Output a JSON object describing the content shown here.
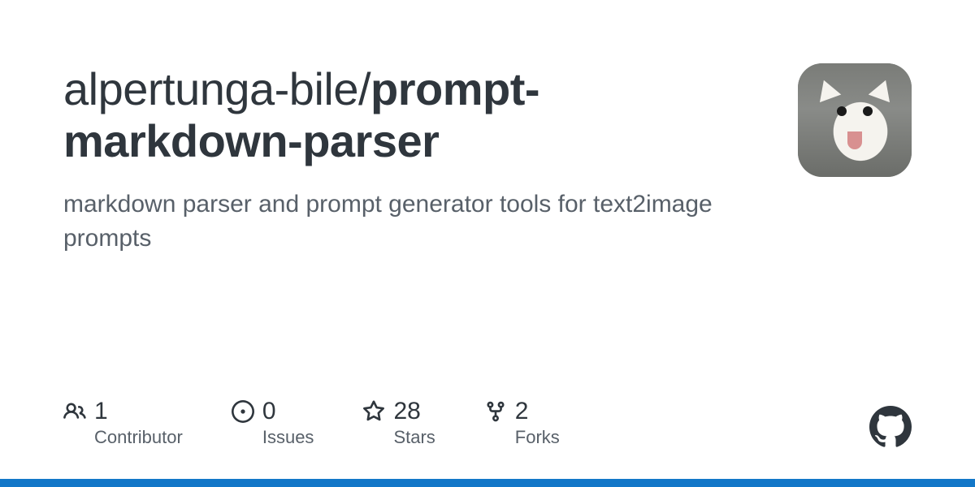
{
  "repo": {
    "owner": "alpertunga-bile",
    "separator": "/",
    "name": "prompt-markdown-parser",
    "description": "markdown parser and prompt generator tools for text2image prompts"
  },
  "stats": {
    "contributors": {
      "value": "1",
      "label": "Contributor"
    },
    "issues": {
      "value": "0",
      "label": "Issues"
    },
    "stars": {
      "value": "28",
      "label": "Stars"
    },
    "forks": {
      "value": "2",
      "label": "Forks"
    }
  },
  "colors": {
    "accent_bar": "#1277c8",
    "text_primary": "#2f363d",
    "text_secondary": "#586069"
  }
}
